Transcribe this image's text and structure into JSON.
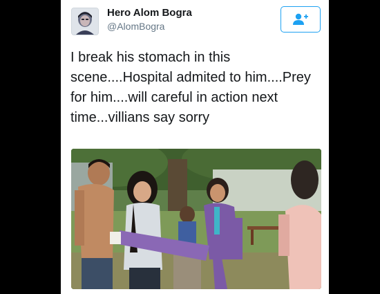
{
  "tweet": {
    "display_name": "Hero Alom Bogra",
    "handle": "@AlomBogra",
    "text": "I break his stomach in this scene....Hospital admited to him....Prey for him....will careful in action next time...villians say sorry"
  },
  "icons": {
    "follow": "add-user-icon"
  },
  "colors": {
    "accent": "#1da1f2",
    "text": "#14171a",
    "secondary_text": "#657786",
    "background": "#000000"
  }
}
